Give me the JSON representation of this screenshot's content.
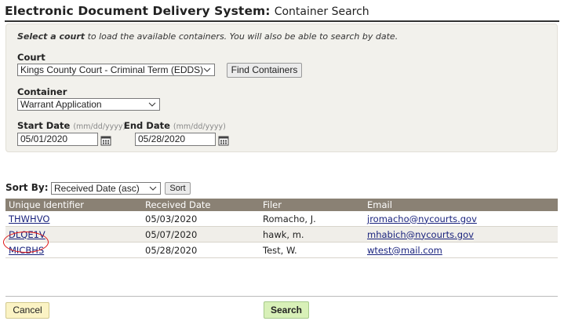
{
  "header": {
    "title_main": "Electronic Document Delivery System:",
    "title_sub": "Container Search"
  },
  "instructions": {
    "bold": "Select a court",
    "rest": "to load the available containers. You will also be able to search by date."
  },
  "court": {
    "label": "Court",
    "value": "Kings County Court - Criminal Term (EDDS)",
    "find_button": "Find Containers"
  },
  "container": {
    "label": "Container",
    "value": "Warrant Application"
  },
  "start_date": {
    "label": "Start Date",
    "hint": "(mm/dd/yyyy)",
    "value": "05/01/2020"
  },
  "end_date": {
    "label": "End Date",
    "hint": "(mm/dd/yyyy)",
    "value": "05/28/2020"
  },
  "sort": {
    "label": "Sort By:",
    "value": "Received Date (asc)",
    "button": "Sort"
  },
  "table": {
    "headers": [
      "Unique Identifier",
      "Received Date",
      "Filer",
      "Email"
    ],
    "rows": [
      {
        "id": "THWHVO",
        "date": "05/03/2020",
        "filer": "Romacho, J.",
        "email": "jromacho@nycourts.gov"
      },
      {
        "id": "DLQE1V",
        "date": "05/07/2020",
        "filer": "hawk, m.",
        "email": "mhabich@nycourts.gov"
      },
      {
        "id": "MICBHS",
        "date": "05/28/2020",
        "filer": "Test, W.",
        "email": "wtest@mail.com"
      }
    ]
  },
  "footer": {
    "cancel": "Cancel",
    "search": "Search"
  },
  "colors": {
    "table_header": "#8a8174",
    "panel_bg": "#f2f1ec",
    "cancel_bg": "#fbf3c4",
    "search_bg": "#d8f0b8",
    "annotation": "#e01616"
  }
}
